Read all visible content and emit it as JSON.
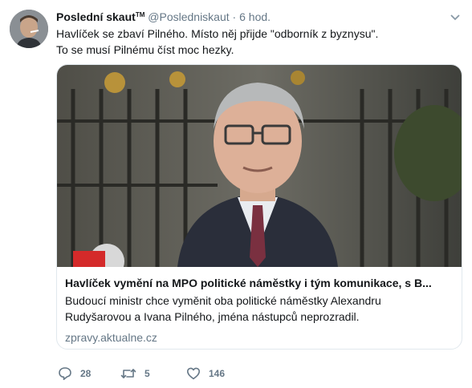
{
  "tweet": {
    "name": "Poslední skaut",
    "name_sup": "TM",
    "handle": "@Posledniskaut",
    "separator": "·",
    "time": "6 hod.",
    "text_line1": "Havlíček se zbaví Pilného. Místo něj přijde \"odborník z byznysu\".",
    "text_line2": "To se musí Pilnému číst moc hezky."
  },
  "card": {
    "title": "Havlíček vymění na MPO politické náměstky i tým komunikace, s B...",
    "description_line1": "Budoucí ministr chce vyměnit oba politické náměstky Alexandru",
    "description_line2": "Rudyšarovou a Ivana Pilného, jména nástupců neprozradil.",
    "domain": "zpravy.aktualne.cz"
  },
  "actions": {
    "replies": "28",
    "retweets": "5",
    "likes": "146"
  },
  "colors": {
    "text_primary": "#14171a",
    "text_secondary": "#657786",
    "card_border": "#e1e8ed"
  }
}
